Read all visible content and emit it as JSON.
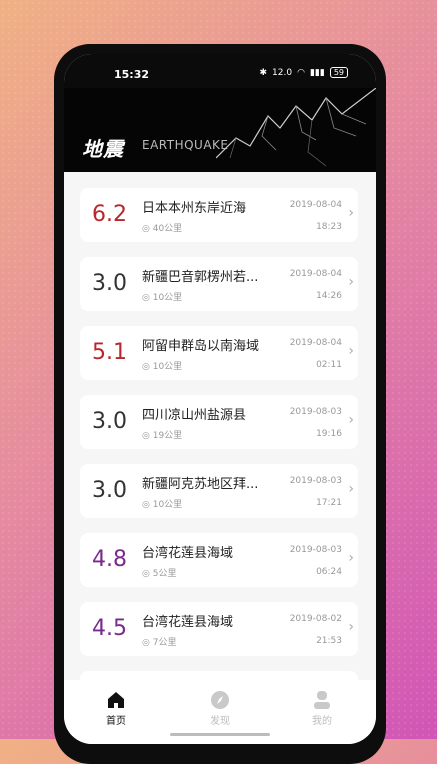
{
  "status_bar": {
    "time": "15:32",
    "speed": "12.0",
    "battery": "59"
  },
  "header": {
    "title_cn": "地震",
    "title_en": "EARTHQUAKE"
  },
  "colors": {
    "red": "#b8272c",
    "purple": "#7a2a8a",
    "gray": "#333333"
  },
  "quakes": [
    {
      "magnitude": "6.2",
      "place": "日本本州东岸近海",
      "depth": "40公里",
      "date": "2019-08-04",
      "time": "18:23",
      "color": "red"
    },
    {
      "magnitude": "3.0",
      "place": "新疆巴音郭楞州若...",
      "depth": "10公里",
      "date": "2019-08-04",
      "time": "14:26",
      "color": "gray"
    },
    {
      "magnitude": "5.1",
      "place": "阿留申群岛以南海域",
      "depth": "10公里",
      "date": "2019-08-04",
      "time": "02:11",
      "color": "red"
    },
    {
      "magnitude": "3.0",
      "place": "四川凉山州盐源县",
      "depth": "19公里",
      "date": "2019-08-03",
      "time": "19:16",
      "color": "gray"
    },
    {
      "magnitude": "3.0",
      "place": "新疆阿克苏地区拜...",
      "depth": "10公里",
      "date": "2019-08-03",
      "time": "17:21",
      "color": "gray"
    },
    {
      "magnitude": "4.8",
      "place": "台湾花莲县海域",
      "depth": "5公里",
      "date": "2019-08-03",
      "time": "06:24",
      "color": "purple"
    },
    {
      "magnitude": "4.5",
      "place": "台湾花莲县海域",
      "depth": "7公里",
      "date": "2019-08-02",
      "time": "21:53",
      "color": "purple"
    }
  ],
  "tabs": [
    {
      "label": "首页",
      "icon": "home-icon",
      "active": true
    },
    {
      "label": "发现",
      "icon": "compass-icon",
      "active": false
    },
    {
      "label": "我的",
      "icon": "user-icon",
      "active": false
    }
  ]
}
